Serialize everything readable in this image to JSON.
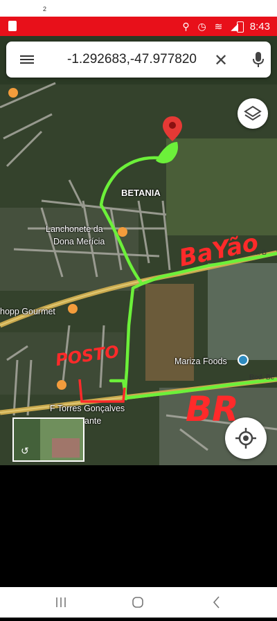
{
  "top": {
    "page_number": "2"
  },
  "status_bar": {
    "time": "8:43",
    "background": "#e8101a"
  },
  "search": {
    "query": "-1.292683,-47.977820"
  },
  "map_labels": {
    "betania": "BETANIA",
    "lanchonete_line1": "Lanchonete da",
    "lanchonete_line2": "Dona Merícia",
    "chopp": "hopp Gourmet",
    "mariza": "Mariza Foods",
    "torres_line1": "F Torres Gonçalves",
    "torres_line2": "ante",
    "road_av": "Av. B",
    "road_rod": "Rod. Be"
  },
  "annotations": {
    "bayao": "BaYão",
    "posto": "POSTO",
    "br": "BR",
    "route_color": "#6cf03a",
    "ink_color": "#ff2a2a"
  },
  "icons": [
    "menu-icon",
    "close-icon",
    "mic-icon",
    "layers-icon",
    "my-location-icon",
    "destination-pin-icon",
    "nav-recent-icon",
    "nav-home-icon",
    "nav-back-icon"
  ]
}
